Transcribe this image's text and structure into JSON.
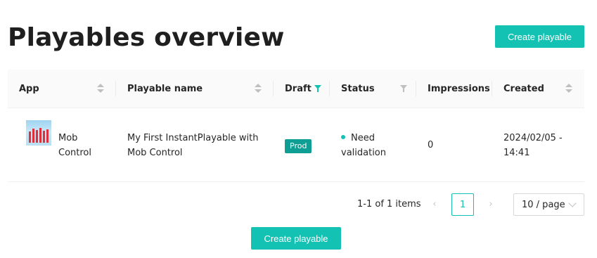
{
  "page": {
    "title": "Playables overview",
    "create_button_label": "Create playable"
  },
  "table": {
    "columns": {
      "app": "App",
      "playable_name": "Playable name",
      "draft": "Draft",
      "status": "Status",
      "impressions": "Impressions",
      "created": "Created"
    },
    "rows": [
      {
        "app_line1": "Mob",
        "app_line2": "Control",
        "name_line1": "My First InstantPlayable with",
        "name_line2": "Mob Control",
        "draft": "Prod",
        "status_line1": "Need",
        "status_line2": "validation",
        "impressions": "0",
        "created_line1": "2024/02/05 -",
        "created_line2": "14:41"
      }
    ]
  },
  "pagination": {
    "total_text": "1-1 of 1 items",
    "current_page": "1",
    "page_size": "10 / page"
  },
  "colors": {
    "accent": "#13c2b2",
    "tag": "#0f9e94",
    "filter_active": "#13c2b2",
    "filter_inactive": "#bfbfbf"
  },
  "icons": {
    "sort": "sort-arrows-icon",
    "filter": "filter-funnel-icon",
    "prev": "chevron-left-icon",
    "next": "chevron-right-icon",
    "dropdown": "chevron-down-icon"
  }
}
